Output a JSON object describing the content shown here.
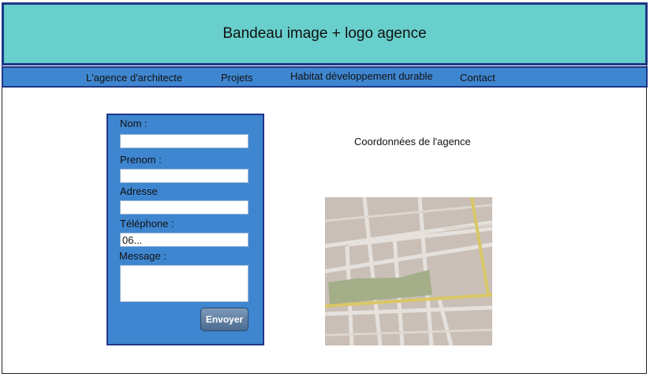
{
  "banner": {
    "text": "Bandeau image + logo agence"
  },
  "nav": {
    "items": [
      {
        "label": "L'agence d'architecte"
      },
      {
        "label": "Projets"
      },
      {
        "label": "Habitat développement durable"
      },
      {
        "label": "Contact"
      }
    ]
  },
  "form": {
    "nom_label": "Nom :",
    "prenom_label": "Prenom :",
    "adresse_label": "Adresse",
    "telephone_label": "Téléphone :",
    "telephone_value": "06...",
    "message_label": "Message :",
    "submit_label": "Envoyer"
  },
  "coordinates": {
    "title": "Coordonnées de l'agence"
  },
  "map": {
    "icon": "map-image"
  },
  "colors": {
    "banner": "#68cfcc",
    "nav": "#3f86d0",
    "border": "#1f3787",
    "form": "#3f86d0"
  }
}
